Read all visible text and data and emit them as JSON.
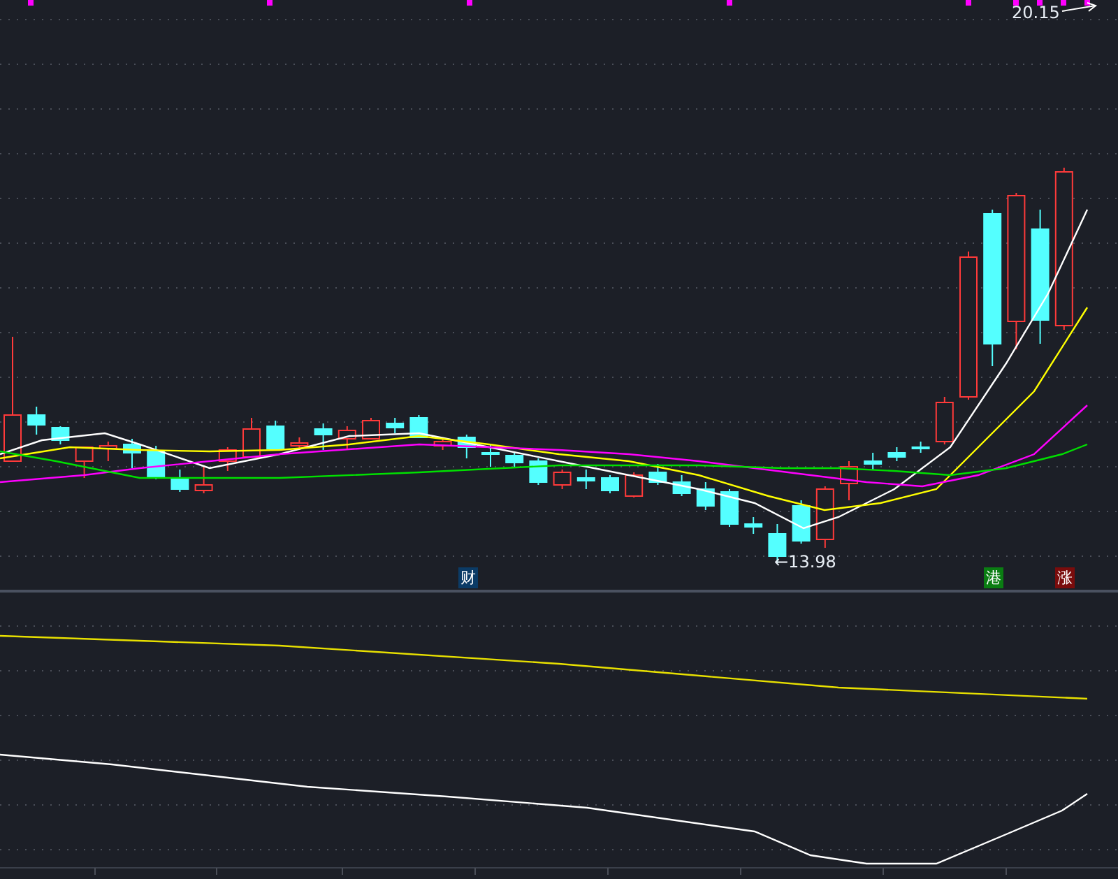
{
  "chart": {
    "high_label": "20.15",
    "low_label": "←13.98"
  },
  "event_markers": [
    {
      "label": "财",
      "color": "#0b3b66"
    },
    {
      "label": "港",
      "color": "#0a7d12"
    },
    {
      "label": "涨",
      "color": "#7a0c0c"
    }
  ]
}
